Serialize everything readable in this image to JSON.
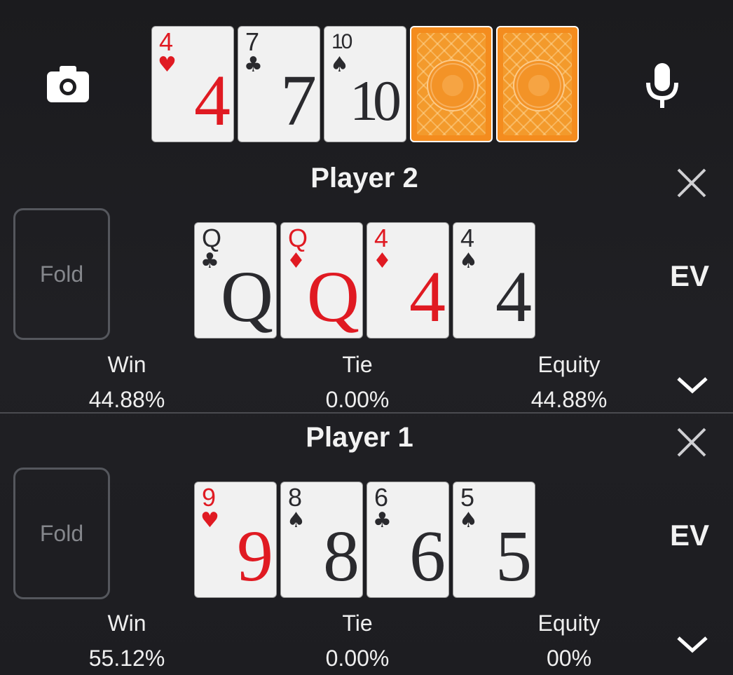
{
  "board": {
    "cards": [
      {
        "rank": "4",
        "suit": "♥",
        "color": "red"
      },
      {
        "rank": "7",
        "suit": "♣",
        "color": "black"
      },
      {
        "rank": "10",
        "suit": "♠",
        "color": "black"
      }
    ],
    "hidden_cards": 2,
    "left_icon": "camera-icon",
    "right_icon": "microphone-icon"
  },
  "players": [
    {
      "title": "Player 2",
      "fold_label": "Fold",
      "ev_label": "EV",
      "cards": [
        {
          "rank": "Q",
          "suit": "♣",
          "color": "black"
        },
        {
          "rank": "Q",
          "suit": "♦",
          "color": "red"
        },
        {
          "rank": "4",
          "suit": "♦",
          "color": "red"
        },
        {
          "rank": "4",
          "suit": "♠",
          "color": "black"
        }
      ],
      "stats": {
        "win_label": "Win",
        "win_value": "44.88%",
        "tie_label": "Tie",
        "tie_value": "0.00%",
        "equity_label": "Equity",
        "equity_value": "44.88%"
      }
    },
    {
      "title": "Player 1",
      "fold_label": "Fold",
      "ev_label": "EV",
      "cards": [
        {
          "rank": "9",
          "suit": "♥",
          "color": "red"
        },
        {
          "rank": "8",
          "suit": "♠",
          "color": "black"
        },
        {
          "rank": "6",
          "suit": "♣",
          "color": "black"
        },
        {
          "rank": "5",
          "suit": "♠",
          "color": "black"
        }
      ],
      "stats": {
        "win_label": "Win",
        "win_value": "55.12%",
        "tie_label": "Tie",
        "tie_value": "0.00%",
        "equity_label": "Equity",
        "equity_value": "00%"
      }
    }
  ],
  "colors": {
    "red": "#e01a22",
    "black": "#2a2a2e",
    "card_back": "#f48c1e"
  }
}
